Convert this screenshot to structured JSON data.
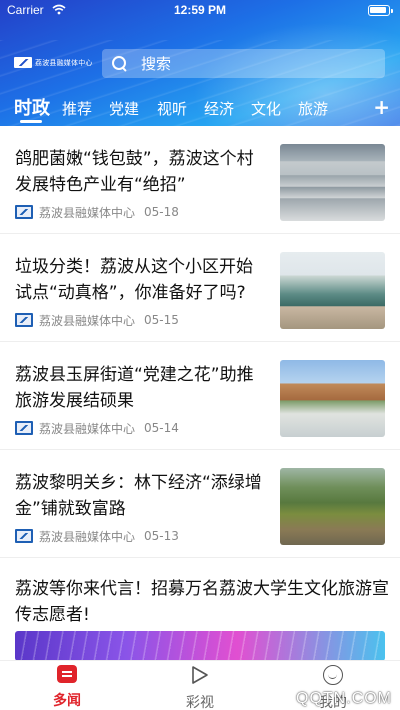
{
  "status_bar": {
    "carrier": "Carrier",
    "time": "12:59 PM"
  },
  "header": {
    "logo_text": "荔波县融媒体中心",
    "search_placeholder": "搜索",
    "tabs": [
      {
        "label": "时政",
        "active": true
      },
      {
        "label": "推荐"
      },
      {
        "label": "党建"
      },
      {
        "label": "视听"
      },
      {
        "label": "经济"
      },
      {
        "label": "文化"
      },
      {
        "label": "旅游"
      }
    ],
    "add_tab": "+"
  },
  "feed": {
    "articles": [
      {
        "title": "鸽肥菌嫩“钱包鼓”，荔波这个村发展特色产业有“绝招”",
        "source": "荔波县融媒体中心",
        "date": "05-18"
      },
      {
        "title": "垃圾分类！荔波从这个小区开始试点“动真格”，你准备好了吗?",
        "source": "荔波县融媒体中心",
        "date": "05-15"
      },
      {
        "title": "荔波县玉屏街道“党建之花”助推旅游发展结硕果",
        "source": "荔波县融媒体中心",
        "date": "05-14"
      },
      {
        "title": "荔波黎明关乡：林下经济“添绿增金”铺就致富路",
        "source": "荔波县融媒体中心",
        "date": "05-13"
      }
    ],
    "wide_article": {
      "title": "荔波等你来代言！招募万名荔波大学生文化旅游宣传志愿者!"
    }
  },
  "bottom_nav": {
    "items": [
      {
        "label": "多闻",
        "icon": "news-icon",
        "active": true
      },
      {
        "label": "彩视",
        "icon": "play-icon"
      },
      {
        "label": "我的",
        "icon": "face-icon"
      }
    ]
  },
  "watermark": "QQTN.COM",
  "colors": {
    "header_blue": "#1d6fe6",
    "accent_red": "#e0242b",
    "meta_gray": "#888888"
  }
}
